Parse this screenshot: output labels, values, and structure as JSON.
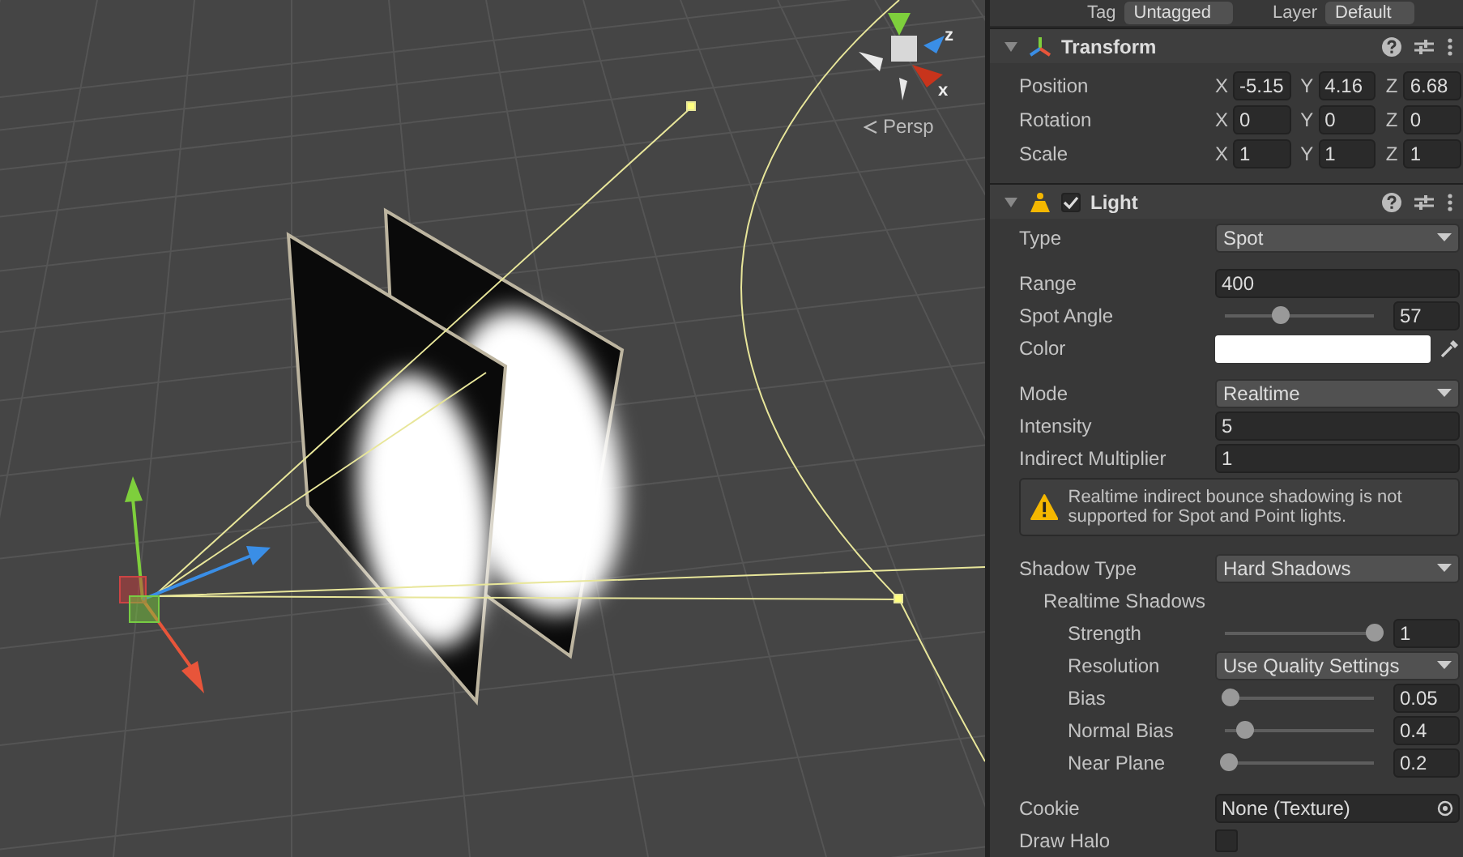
{
  "scene": {
    "view_mode": "Persp",
    "axis_labels": [
      "z",
      "x"
    ]
  },
  "header": {
    "tag_label": "Tag",
    "tag_value": "Untagged",
    "layer_label": "Layer",
    "layer_value": "Default"
  },
  "components": [
    {
      "kind": "transform",
      "title": "Transform",
      "expanded": true,
      "rows": [
        {
          "label": "Position",
          "values": [
            {
              "axis": "X",
              "value": "-5.15"
            },
            {
              "axis": "Y",
              "value": "4.16"
            },
            {
              "axis": "Z",
              "value": "6.68"
            }
          ]
        },
        {
          "label": "Rotation",
          "values": [
            {
              "axis": "X",
              "value": "0"
            },
            {
              "axis": "Y",
              "value": "0"
            },
            {
              "axis": "Z",
              "value": "0"
            }
          ]
        },
        {
          "label": "Scale",
          "values": [
            {
              "axis": "X",
              "value": "1"
            },
            {
              "axis": "Y",
              "value": "1"
            },
            {
              "axis": "Z",
              "value": "1"
            }
          ]
        }
      ]
    },
    {
      "kind": "light",
      "title": "Light",
      "expanded": true,
      "enabled": true,
      "sections": [
        [
          {
            "kind": "dropdown",
            "label": "Type",
            "value": "Spot"
          }
        ],
        [
          {
            "kind": "field",
            "label": "Range",
            "value": "400"
          },
          {
            "kind": "slider",
            "label": "Spot Angle",
            "level": 0.37,
            "value": "57"
          },
          {
            "kind": "color",
            "label": "Color",
            "color": "#ffffff"
          }
        ],
        [
          {
            "kind": "dropdown",
            "label": "Mode",
            "value": "Realtime"
          },
          {
            "kind": "field",
            "label": "Intensity",
            "value": "5"
          },
          {
            "kind": "field",
            "label": "Indirect Multiplier",
            "value": "1"
          },
          {
            "kind": "warning",
            "text": "Realtime indirect bounce shadowing is not supported for Spot and Point lights."
          }
        ],
        [
          {
            "kind": "dropdown",
            "label": "Shadow Type",
            "value": "Hard Shadows"
          },
          {
            "kind": "group",
            "label": "Realtime Shadows",
            "children": [
              {
                "kind": "slider",
                "label": "Strength",
                "level": 1,
                "value": "1"
              },
              {
                "kind": "dropdown",
                "label": "Resolution",
                "value": "Use Quality Settings"
              },
              {
                "kind": "slider",
                "label": "Bias",
                "level": 0.03,
                "value": "0.05"
              },
              {
                "kind": "slider",
                "label": "Normal Bias",
                "level": 0.13,
                "value": "0.4"
              },
              {
                "kind": "slider",
                "label": "Near Plane",
                "level": 0.02,
                "value": "0.2"
              }
            ]
          }
        ],
        [
          {
            "kind": "object",
            "label": "Cookie",
            "value": "None (Texture)"
          },
          {
            "kind": "checkbox",
            "label": "Draw Halo",
            "checked": false
          }
        ]
      ]
    }
  ]
}
